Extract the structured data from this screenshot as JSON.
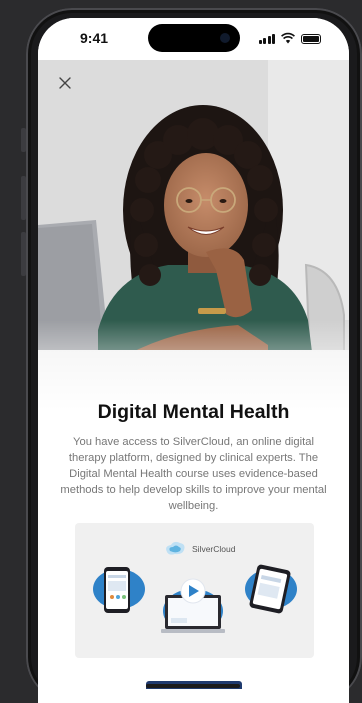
{
  "status_bar": {
    "time": "9:41"
  },
  "header": {
    "close_icon": "close-icon"
  },
  "content": {
    "title": "Digital Mental Health",
    "description": "You have access to SilverCloud, an online digital therapy platform, designed by clinical experts. The Digital Mental Health course uses evidence-based methods to help develop skills to improve your mental wellbeing."
  },
  "promo": {
    "brand": "SilverCloud"
  },
  "colors": {
    "accent": "#2f82c8",
    "cta": "#1f3a6e",
    "title": "#111111",
    "body": "#777777"
  }
}
